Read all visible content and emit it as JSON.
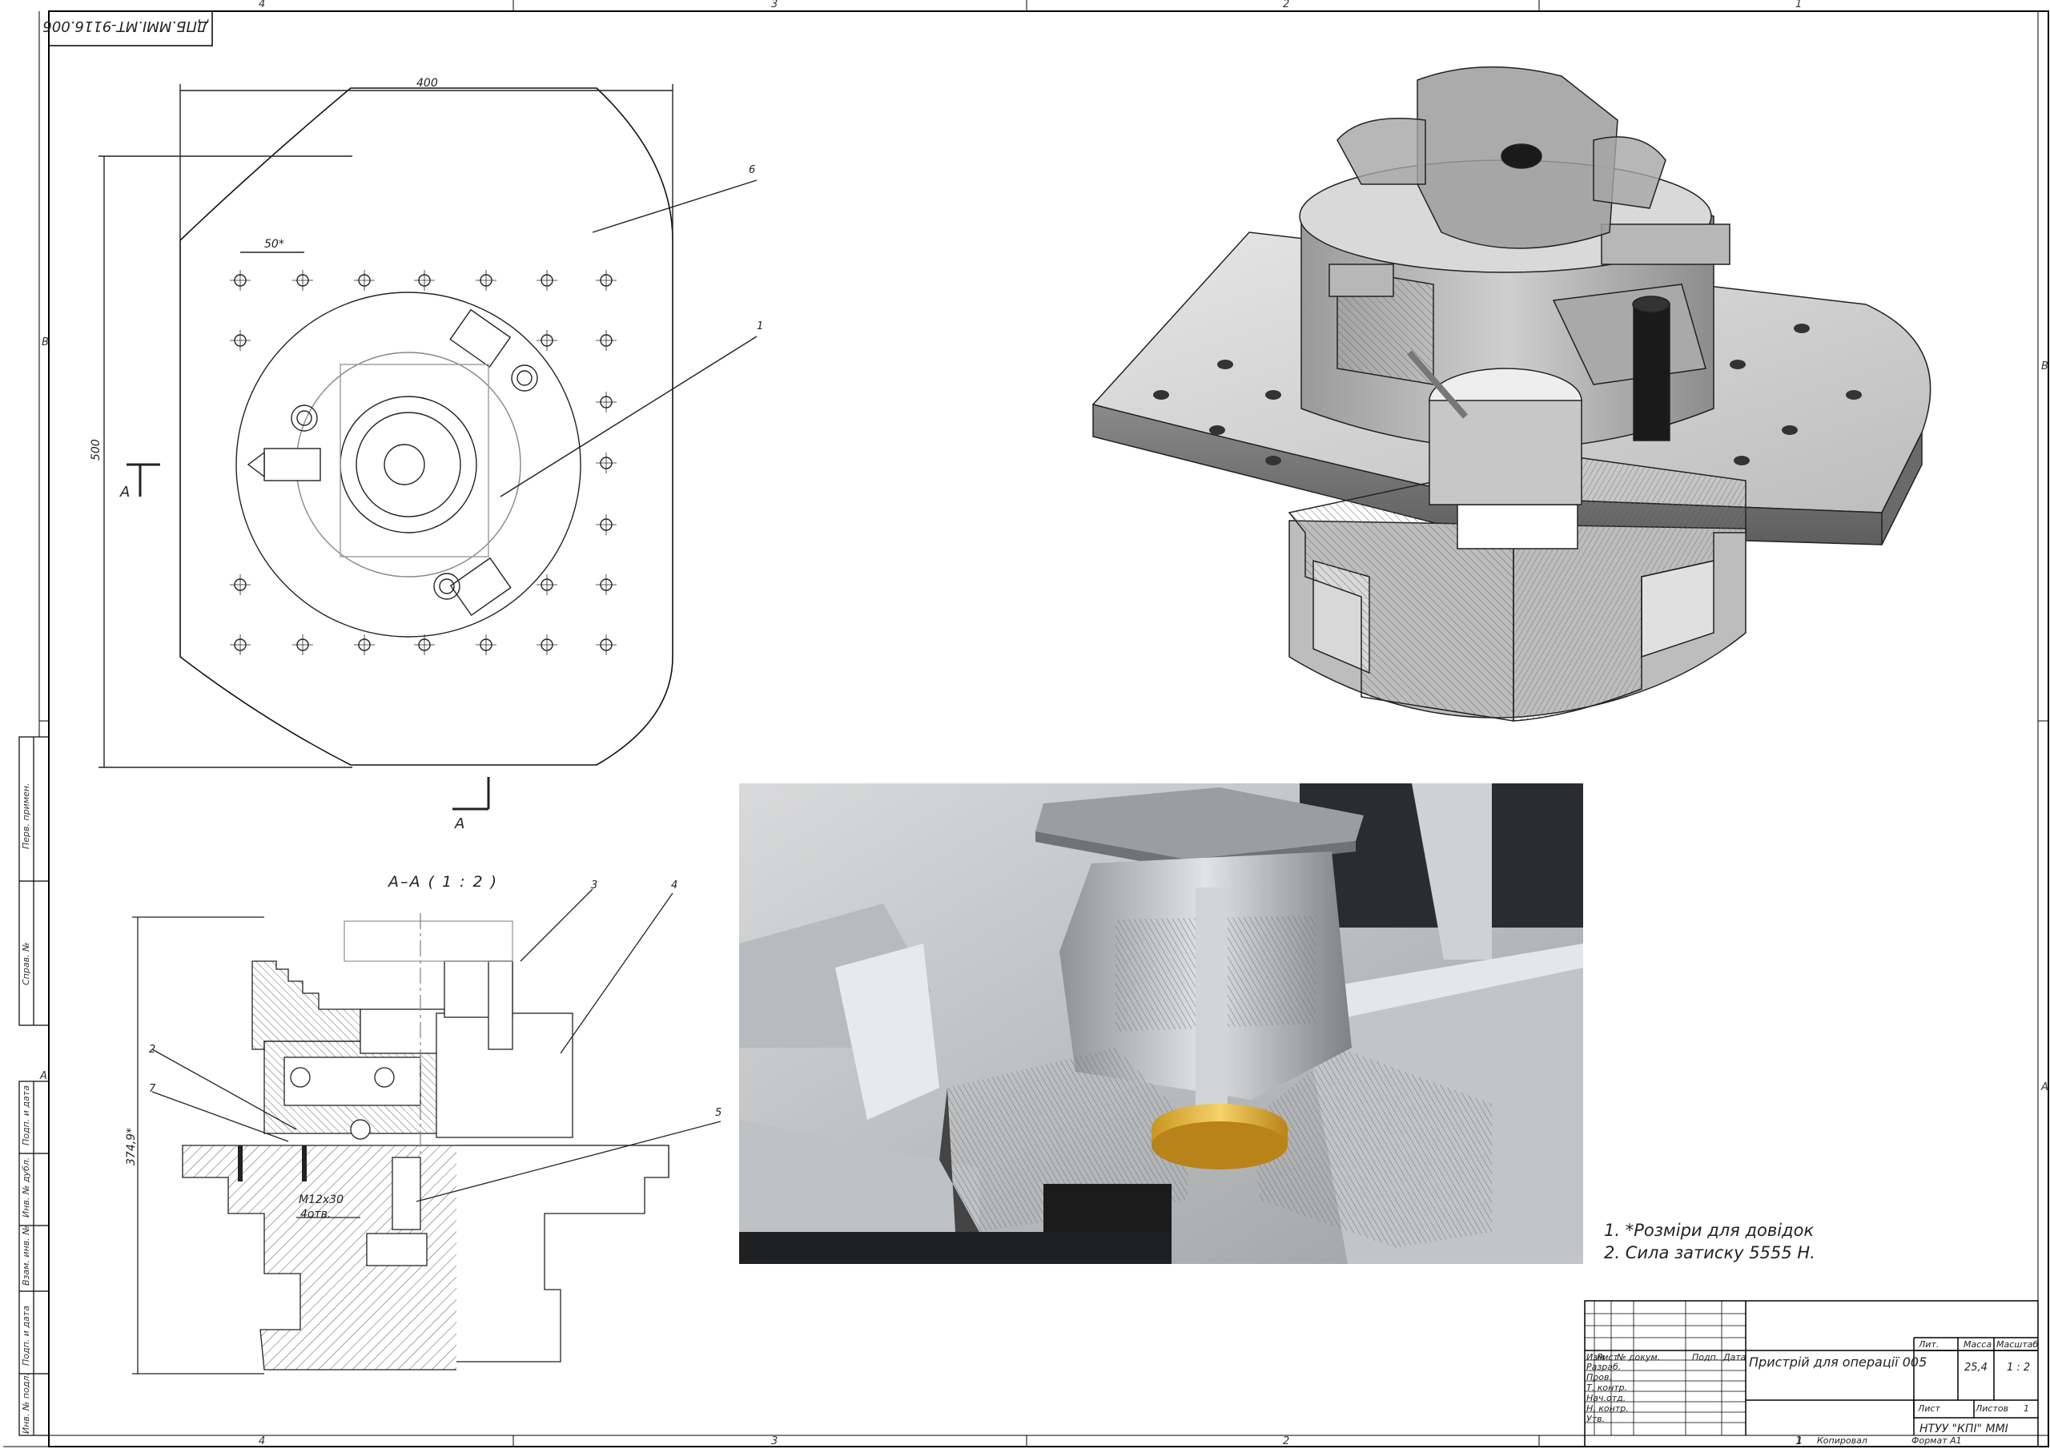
{
  "doc_code": "ДПБ.ММІ.МТ-9116.006",
  "zones_top": [
    "4",
    "3",
    "2",
    "1"
  ],
  "zones_bottom": [
    "4",
    "3",
    "2",
    "1"
  ],
  "zones_left": [
    "B",
    "A"
  ],
  "zones_right": [
    "B",
    "A"
  ],
  "side_stamp": [
    "Перв. примен.",
    "Справ. №",
    "Подп. и дата",
    "Инв. № дубл.",
    "Взам. инв. №",
    "Подп. и дата",
    "Инв. № подл."
  ],
  "plan_view": {
    "dim_width": "400",
    "dim_height": "500",
    "dim_pitch": "50*",
    "leaders": [
      "6",
      "1"
    ],
    "section_marker": "A"
  },
  "section_view": {
    "title": "A–A ( 1 : 2 )",
    "dim_height": "374,9*",
    "thread": "M12x30",
    "holes": "4отв.",
    "leaders": [
      "3",
      "4",
      "2",
      "7",
      "5"
    ]
  },
  "notes": [
    "1. *Розміри для довідок",
    "2. Сила затиску 5555 Н."
  ],
  "title_block": {
    "headers": [
      "Изм",
      "Лист",
      "№ докум.",
      "Подп.",
      "Дата"
    ],
    "roles": [
      "Разраб.",
      "Пров.",
      "Т. контр.",
      "Нач.отд.",
      "Н. контр.",
      "Утв."
    ],
    "doc_title": "Пристрій для операції 005",
    "col_labels": [
      "Лит.",
      "Масса",
      "Масштаб"
    ],
    "mass": "25,4",
    "scale": "1 : 2",
    "sheet_label": "Лист",
    "sheets_label": "Листов",
    "sheets_count": "1",
    "organization": "НТУУ \"КПІ\" ММІ",
    "copied": "Копировал",
    "format": "Формат А1",
    "sheet_no": "1"
  }
}
